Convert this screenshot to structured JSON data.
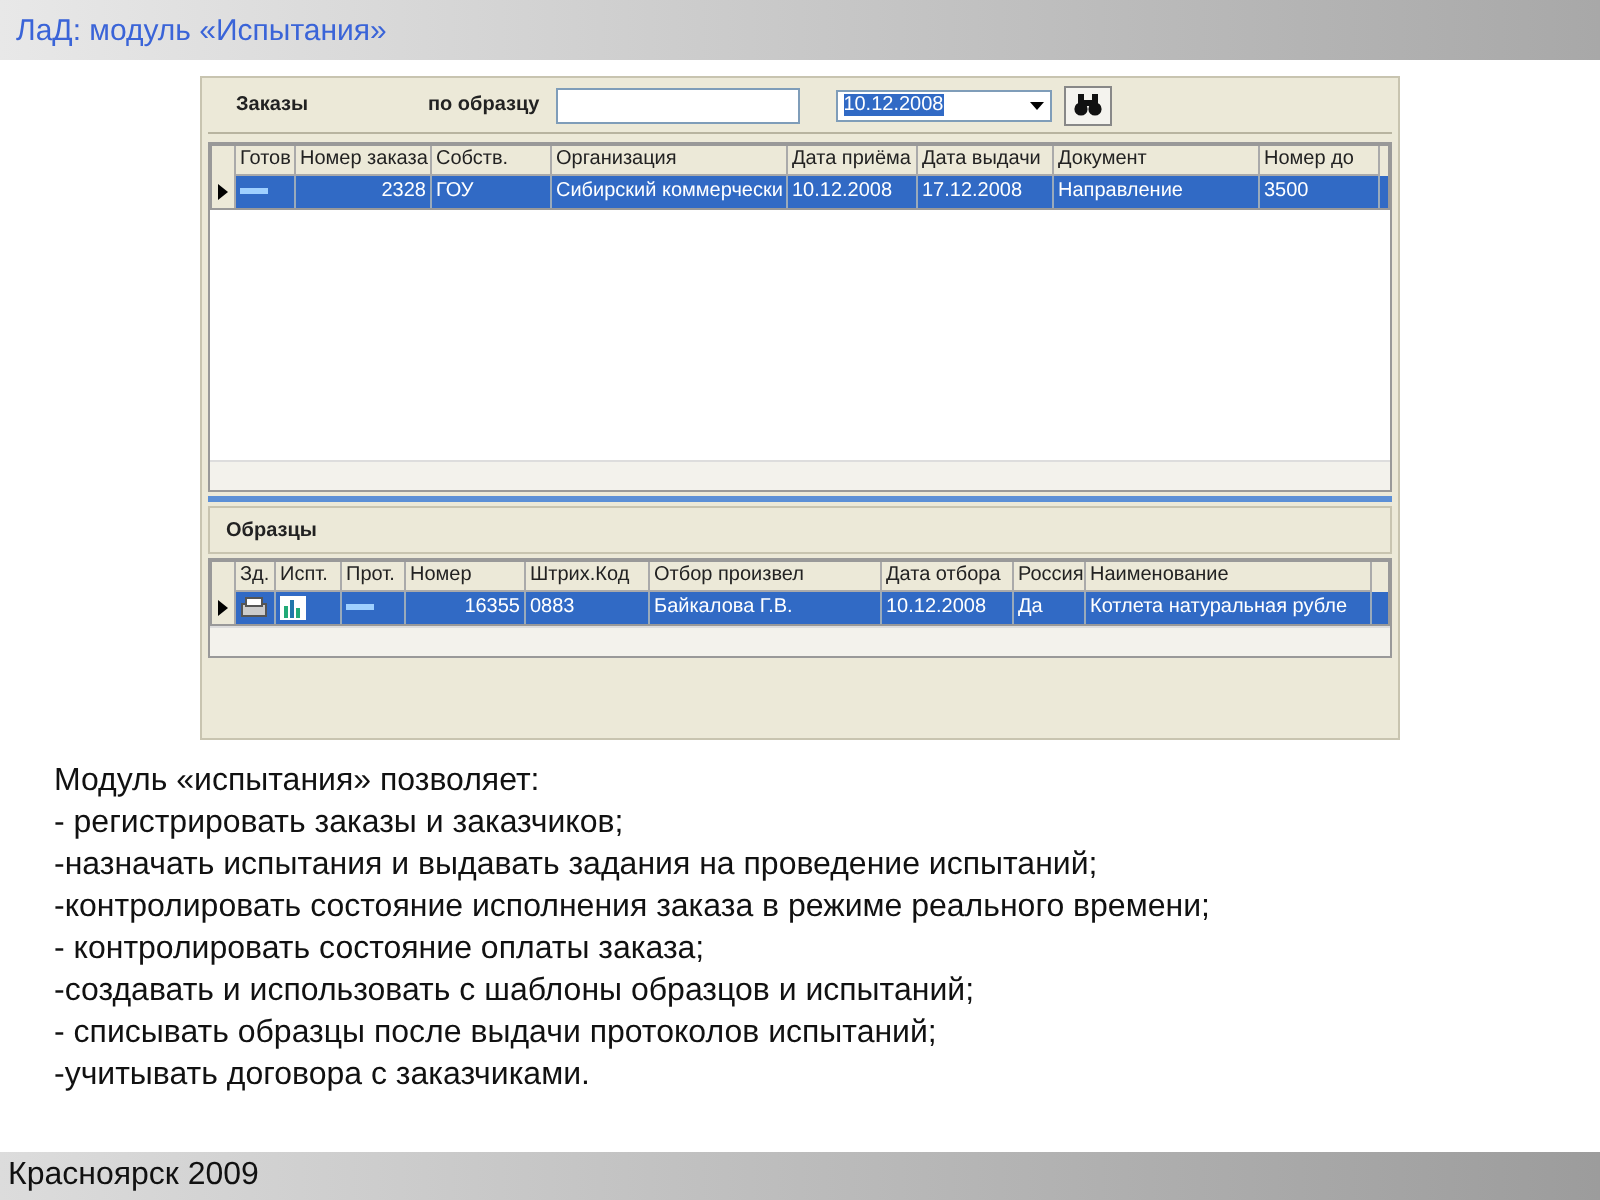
{
  "header": {
    "title": "ЛаД: модуль «Испытания»"
  },
  "orders": {
    "label": "Заказы",
    "search_label": "по образцу",
    "date": "10.12.2008",
    "columns": [
      "Готов",
      "Номер заказа",
      "Собств.",
      "Организация",
      "Дата приёма",
      "Дата выдачи",
      "Документ",
      "Номер до"
    ],
    "rows": [
      {
        "selected": true,
        "cells": [
          "",
          "2328",
          "ГОУ",
          "Сибирский коммерчески",
          "10.12.2008",
          "17.12.2008",
          "Направление",
          "3500"
        ]
      }
    ]
  },
  "samples": {
    "label": "Образцы",
    "columns": [
      "Зд.",
      "Испт.",
      "Прот.",
      "Номер",
      "Штрих.Код",
      "Отбор произвел",
      "Дата отбора",
      "Россия",
      "Наименование"
    ],
    "rows": [
      {
        "selected": true,
        "cells": [
          "",
          "",
          "",
          "16355",
          "0883",
          "Байкалова Г.В.",
          "10.12.2008",
          "Да",
          "Котлета натуральная рубле"
        ]
      }
    ]
  },
  "description": {
    "intro": "Модуль «испытания» позволяет:",
    "items": [
      "- регистрировать заказы и заказчиков;",
      "-назначать испытания и выдавать задания на проведение испытаний;",
      "-контролировать состояние исполнения заказа в режиме реального времени;",
      "- контролировать состояние оплаты заказа;",
      "-создавать и использовать с шаблоны образцов и испытаний;",
      "- списывать образцы после выдачи протоколов испытаний;",
      "-учитывать договора с заказчиками."
    ]
  },
  "footer": {
    "text": "Красноярск 2009"
  }
}
